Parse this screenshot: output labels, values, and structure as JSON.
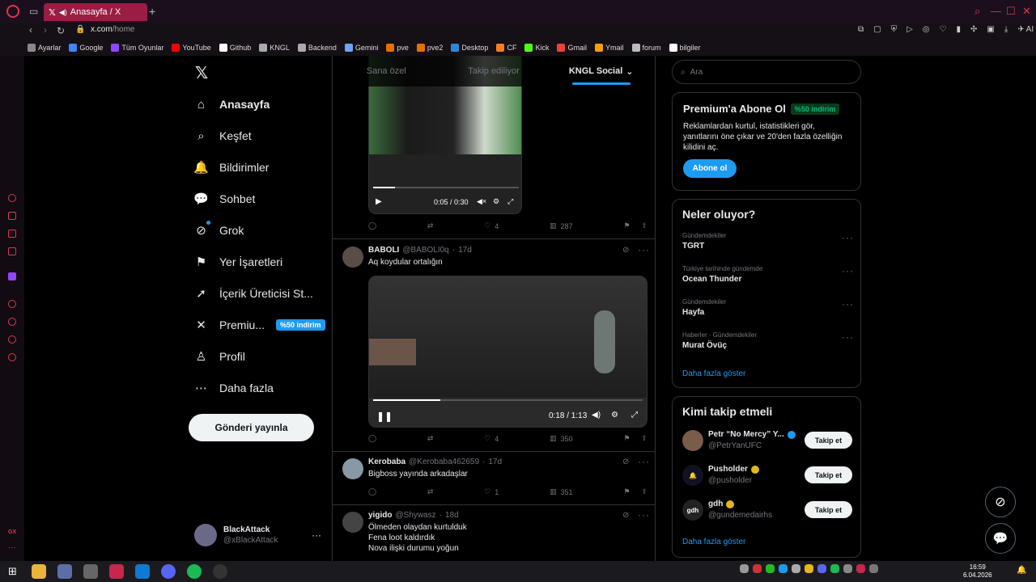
{
  "browser": {
    "tab_title": "Anasayfa / X",
    "url_host": "x.com",
    "url_path": "/home",
    "new_tab_glyph": "+",
    "ai_label": "AI",
    "bookmarks": [
      {
        "label": "Ayarlar",
        "color": "#888888"
      },
      {
        "label": "Google",
        "color": "#4285f4"
      },
      {
        "label": "Tüm Oyunlar",
        "color": "#9146ff"
      },
      {
        "label": "YouTube",
        "color": "#ff0000"
      },
      {
        "label": "Github",
        "color": "#ffffff"
      },
      {
        "label": "KNGL",
        "color": "#aaaaaa"
      },
      {
        "label": "Backend",
        "color": "#aaaaaa"
      },
      {
        "label": "Gemini",
        "color": "#6ba4f8"
      },
      {
        "label": "pve",
        "color": "#e57000"
      },
      {
        "label": "pve2",
        "color": "#e57000"
      },
      {
        "label": "Desktop",
        "color": "#2b88d8"
      },
      {
        "label": "CF",
        "color": "#f38020"
      },
      {
        "label": "Kick",
        "color": "#53fc18"
      },
      {
        "label": "Gmail",
        "color": "#ea4335"
      },
      {
        "label": "Ymail",
        "color": "#f59e0b"
      },
      {
        "label": "forum",
        "color": "#bbbbbb"
      },
      {
        "label": "bilgiler",
        "color": "#ffffff"
      }
    ]
  },
  "nav": {
    "items": [
      {
        "label": "Anasayfa",
        "icon": "home-icon",
        "glyph": "⌂"
      },
      {
        "label": "Keşfet",
        "icon": "search-icon",
        "glyph": "⌕"
      },
      {
        "label": "Bildirimler",
        "icon": "bell-icon",
        "glyph": "🔔"
      },
      {
        "label": "Sohbet",
        "icon": "chat-icon",
        "glyph": "💬"
      },
      {
        "label": "Grok",
        "icon": "grok-icon",
        "glyph": "⊘"
      },
      {
        "label": "Yer İşaretleri",
        "icon": "bookmark-icon",
        "glyph": "⚑"
      },
      {
        "label": "İçerik Üreticisi St...",
        "icon": "rocket-icon",
        "glyph": "➚"
      },
      {
        "label": "Premiu...",
        "icon": "x-logo-icon",
        "glyph": "✕"
      },
      {
        "label": "Profil",
        "icon": "profile-icon",
        "glyph": "♙"
      },
      {
        "label": "Daha fazla",
        "icon": "more-icon",
        "glyph": "⋯"
      }
    ],
    "premium_badge": "%50 indirim",
    "post_button": "Gönderi yayınla",
    "account_name": "BlackAttack",
    "account_handle": "@xBlackAttack",
    "account_more": "···"
  },
  "feed": {
    "tabs": [
      "Sana özel",
      "Takip ediliyor",
      "KNGL Social"
    ],
    "first_post": {
      "video_time": "0:05 / 0:30",
      "views": "287",
      "likes": "4",
      "progress": 0.15
    },
    "posts": [
      {
        "name": "BABOLI",
        "handle": "@BABOLI0q",
        "age": "17d",
        "text": [
          "Aq koydular ortalığın"
        ],
        "has_video": true,
        "video_time": "0:18 / 1:13",
        "progress": 0.25,
        "replies": "",
        "reposts": "",
        "likes": "4",
        "views": "350",
        "avatar_color": "#5a4d48"
      },
      {
        "name": "Kerobaba",
        "handle": "@Kerobaba462659",
        "age": "17d",
        "text": [
          "Bigboss yayında arkadaşlar"
        ],
        "has_video": false,
        "replies": "",
        "reposts": "",
        "likes": "1",
        "views": "351",
        "avatar_color": "#8899a6"
      },
      {
        "name": "yigido",
        "handle": "@Shywasz",
        "age": "18d",
        "text": [
          "Ölmeden olaydan kurtulduk",
          "Fena loot kaldırdık",
          "Nova ilişki durumu yoğun"
        ],
        "has_video": false,
        "avatar_color": "#444444"
      }
    ]
  },
  "sidebar": {
    "search_placeholder": "Ara",
    "premium": {
      "title": "Premium'a Abone Ol",
      "badge": "%50 indirim",
      "body": "Reklamlardan kurtul, istatistikleri gör, yanıtlarını öne çıkar ve 20'den fazla özelliğin kilidini aç.",
      "button": "Abone ol"
    },
    "trends": {
      "title": "Neler oluyor?",
      "items": [
        {
          "category": "Gündemdekiler",
          "name": "TGRT"
        },
        {
          "category": "Türkiye tarihinde gündemde",
          "name": "Ocean Thunder"
        },
        {
          "category": "Gündemdekiler",
          "name": "Hayfa"
        },
        {
          "category": "Haberler · Gündemdekiler",
          "name": "Murat Övüç"
        }
      ],
      "more": "Daha fazla göster"
    },
    "who_to_follow": {
      "title": "Kimi takip etmeli",
      "items": [
        {
          "name": "Petr “No Mercy” Y...",
          "handle": "@PetrYanUFC",
          "badge_color": "#1d9bf0",
          "avatar_color": "#7a5c4a",
          "avatar_text": ""
        },
        {
          "name": "Pusholder",
          "handle": "@pusholder",
          "badge_color": "#e2b719",
          "avatar_color": "#111122",
          "avatar_text": "🔔"
        },
        {
          "name": "gdh",
          "handle": "@gundemedairhs",
          "badge_color": "#e2b719",
          "avatar_color": "#222222",
          "avatar_text": "gdh"
        }
      ],
      "follow_label": "Takip et",
      "more": "Daha fazla göster"
    }
  },
  "taskbar": {
    "time": "16:59",
    "date": "6.04.2026"
  }
}
